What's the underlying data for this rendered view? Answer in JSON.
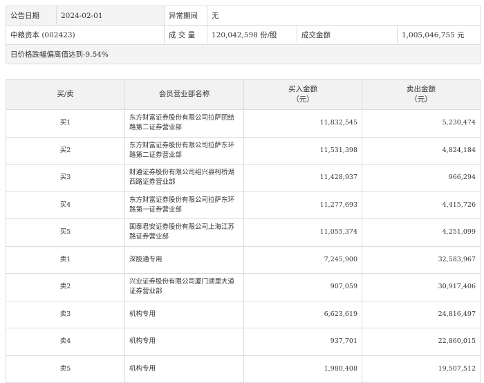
{
  "info": {
    "date_label": "公告日期",
    "date_value": "2024-02-01",
    "abnormal_label": "异常期间",
    "abnormal_value": "无",
    "stock": "中粮资本 (002423)",
    "volume_label": "成 交 量",
    "volume_value": "120,042,598 份/股",
    "amount_label": "成交金额",
    "amount_value": "1,005,046,755 元",
    "reason": "日价格跌幅偏离值达到-9.54%"
  },
  "table": {
    "headers": {
      "side": "买/卖",
      "dept": "会员营业部名称",
      "buy_line1": "买入金额",
      "buy_line2": "（元）",
      "sell_line1": "卖出金额",
      "sell_line2": "（元）"
    },
    "rows": [
      {
        "side": "买1",
        "dept": "东方财富证券股份有限公司拉萨团结路第二证券营业部",
        "buy": "11,832,545",
        "sell": "5,230,474"
      },
      {
        "side": "买2",
        "dept": "东方财富证券股份有限公司拉萨东环路第二证券营业部",
        "buy": "11,531,398",
        "sell": "4,824,184"
      },
      {
        "side": "买3",
        "dept": "财通证券股份有限公司绍兴县柯桥湖西路证券营业部",
        "buy": "11,428,937",
        "sell": "966,294"
      },
      {
        "side": "买4",
        "dept": "东方财富证券股份有限公司拉萨东环路第一证券营业部",
        "buy": "11,277,693",
        "sell": "4,415,726"
      },
      {
        "side": "买5",
        "dept": "国泰君安证券股份有限公司上海江苏路证券营业部",
        "buy": "11,055,374",
        "sell": "4,251,099"
      },
      {
        "side": "卖1",
        "dept": "深股通专用",
        "buy": "7,245,900",
        "sell": "32,583,967"
      },
      {
        "side": "卖2",
        "dept": "兴业证券股份有限公司厦门湖里大道证券营业部",
        "buy": "907,059",
        "sell": "30,917,406"
      },
      {
        "side": "卖3",
        "dept": "机构专用",
        "buy": "6,623,619",
        "sell": "24,816,497"
      },
      {
        "side": "卖4",
        "dept": "机构专用",
        "buy": "937,701",
        "sell": "22,860,015"
      },
      {
        "side": "卖5",
        "dept": "机构专用",
        "buy": "1,980,408",
        "sell": "19,507,512"
      }
    ]
  }
}
